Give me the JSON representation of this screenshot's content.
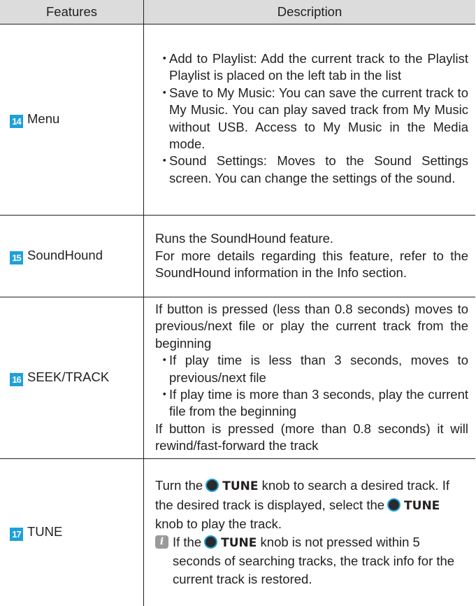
{
  "table": {
    "header": {
      "features": "Features",
      "description": "Description"
    },
    "rows": [
      {
        "num": "14",
        "feature": "Menu",
        "bullets": [
          "Add to Playlist: Add the current track to the Playlist Playlist is placed on the left tab in the list",
          "Save to My Music: You can save the current track to My Music. You can play saved track from My Music without USB.  Access to My Music in the Media mode.",
          "Sound Settings: Moves to the Sound Settings screen. You can change the settings of the sound."
        ]
      },
      {
        "num": "15",
        "feature": "SoundHound",
        "line1": "Runs the SoundHound feature.",
        "line2": "For more details regarding this feature, refer to the SoundHound information in the Info section."
      },
      {
        "num": "16",
        "feature": "SEEK/TRACK",
        "intro": "If button is pressed (less than 0.8 seconds) moves to previous/next file or play the current track from the beginning",
        "bullets": [
          "If play time is less than 3 seconds, moves to previous/next file",
          "If play time is more than 3 seconds, play the current file from the beginning"
        ],
        "outro": "If button is pressed (more than 0.8 seconds) it will rewind/fast-forward the track"
      },
      {
        "num": "17",
        "feature": "TUNE",
        "p1_a": "Turn the",
        "p1_knob": "TUNE",
        "p1_b": "knob to search a desired track. If the desired track is displayed, select the",
        "p1_knob2": "TUNE",
        "p1_c": "knob to play the track.",
        "note_a": "If the",
        "note_knob": "TUNE",
        "note_b": "knob is not pressed within 5 seconds of searching tracks, the track info for the current track is restored."
      }
    ]
  },
  "colors": {
    "accent": "#1ea0dc",
    "header_bg": "#dcdcdc",
    "text": "#231f20",
    "note_icon": "#9a9a9a"
  },
  "icons": {
    "bullet": "・",
    "knob": "tune-knob-icon",
    "note": "info-icon",
    "note_glyph": "i"
  }
}
